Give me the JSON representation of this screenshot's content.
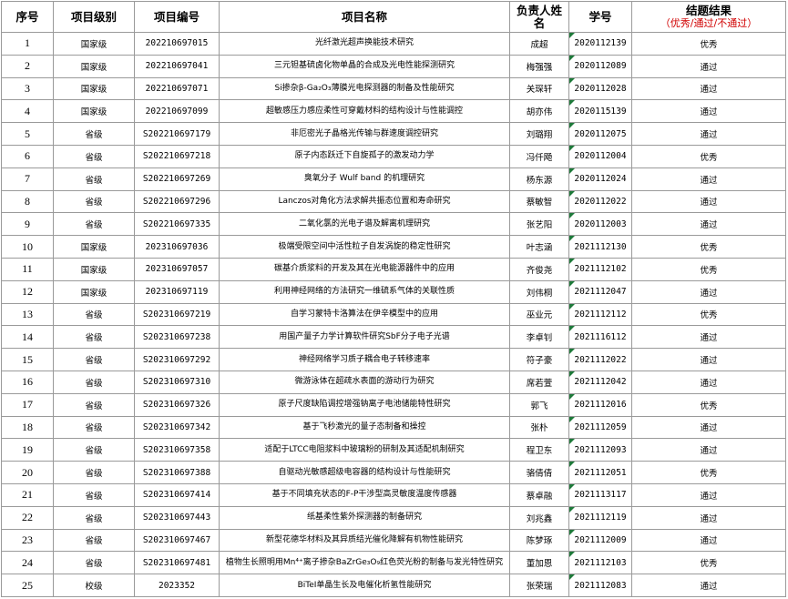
{
  "headers": {
    "seq": "序号",
    "level": "项目级别",
    "code": "项目编号",
    "name": "项目名称",
    "leader": "负责人姓名",
    "sid": "学号",
    "result": "结题结果",
    "result_note": "（优秀/通过/不通过）"
  },
  "rows": [
    {
      "seq": "1",
      "level": "国家级",
      "code": "202210697015",
      "name": "光纤激光超声换能技术研究",
      "leader": "成超",
      "sid": "2020112139",
      "result": "优秀"
    },
    {
      "seq": "2",
      "level": "国家级",
      "code": "202210697041",
      "name": "三元钽基硫卤化物单晶的合成及光电性能探测研究",
      "leader": "梅强强",
      "sid": "2020112089",
      "result": "通过"
    },
    {
      "seq": "3",
      "level": "国家级",
      "code": "202210697071",
      "name": "Si掺杂β-Ga₂O₃薄膜光电探测器的制备及性能研究",
      "leader": "关琛轩",
      "sid": "2020112028",
      "result": "通过"
    },
    {
      "seq": "4",
      "level": "国家级",
      "code": "202210697099",
      "name": "超敏感压力感应柔性可穿戴材料的结构设计与性能调控",
      "leader": "胡亦伟",
      "sid": "2020115139",
      "result": "通过"
    },
    {
      "seq": "5",
      "level": "省级",
      "code": "S202210697179",
      "name": "非厄密光子晶格光传输与群速度调控研究",
      "leader": "刘璐翔",
      "sid": "2020112075",
      "result": "通过"
    },
    {
      "seq": "6",
      "level": "省级",
      "code": "S202210697218",
      "name": "原子内态跃迁下自旋孤子的激发动力学",
      "leader": "冯仟飏",
      "sid": "2020112004",
      "result": "优秀"
    },
    {
      "seq": "7",
      "level": "省级",
      "code": "S202210697269",
      "name": "臭氧分子 Wulf band 的机理研究",
      "leader": "杨东源",
      "sid": "2020112024",
      "result": "通过"
    },
    {
      "seq": "8",
      "level": "省级",
      "code": "S202210697296",
      "name": "Lanczos对角化方法求解共振态位置和寿命研究",
      "leader": "蔡敏智",
      "sid": "2020112022",
      "result": "通过"
    },
    {
      "seq": "9",
      "level": "省级",
      "code": "S202210697335",
      "name": "二氧化氯的光电子谱及解离机理研究",
      "leader": "张艺阳",
      "sid": "2020112003",
      "result": "通过"
    },
    {
      "seq": "10",
      "level": "国家级",
      "code": "202310697036",
      "name": "极端受限空间中活性粒子自发涡旋的稳定性研究",
      "leader": "叶志涵",
      "sid": "2021112130",
      "result": "优秀"
    },
    {
      "seq": "11",
      "level": "国家级",
      "code": "202310697057",
      "name": "碳基介质浆料的开发及其在光电能源器件中的应用",
      "leader": "齐俊尧",
      "sid": "2021112102",
      "result": "优秀"
    },
    {
      "seq": "12",
      "level": "国家级",
      "code": "202310697119",
      "name": "利用神经网络的方法研究一维硫系气体的关联性质",
      "leader": "刘伟桐",
      "sid": "2021112047",
      "result": "通过"
    },
    {
      "seq": "13",
      "level": "省级",
      "code": "S202310697219",
      "name": "自学习蒙特卡洛算法在伊辛模型中的应用",
      "leader": "巫业元",
      "sid": "2021112112",
      "result": "优秀"
    },
    {
      "seq": "14",
      "level": "省级",
      "code": "S202310697238",
      "name": "用国产量子力学计算软件研究SbF分子电子光谱",
      "leader": "李卓钊",
      "sid": "2021116112",
      "result": "通过"
    },
    {
      "seq": "15",
      "level": "省级",
      "code": "S202310697292",
      "name": "神经网络学习质子耦合电子转移速率",
      "leader": "符子豪",
      "sid": "2021112022",
      "result": "通过"
    },
    {
      "seq": "16",
      "level": "省级",
      "code": "S202310697310",
      "name": "微游泳体在超疏水表面的游动行为研究",
      "leader": "席若萱",
      "sid": "2021112042",
      "result": "通过"
    },
    {
      "seq": "17",
      "level": "省级",
      "code": "S202310697326",
      "name": "原子尺度缺陷调控增强钠离子电池储能特性研究",
      "leader": "郭飞",
      "sid": "2021112016",
      "result": "优秀"
    },
    {
      "seq": "18",
      "level": "省级",
      "code": "S202310697342",
      "name": "基于飞秒激光的量子态制备和操控",
      "leader": "张朴",
      "sid": "2021112059",
      "result": "通过"
    },
    {
      "seq": "19",
      "level": "省级",
      "code": "S202310697358",
      "name": "适配于LTCC电阻浆料中玻璃粉的研制及其适配机制研究",
      "leader": "程卫东",
      "sid": "2021112093",
      "result": "通过"
    },
    {
      "seq": "20",
      "level": "省级",
      "code": "S202310697388",
      "name": "自驱动光敏感超级电容器的结构设计与性能研究",
      "leader": "骆倩倩",
      "sid": "2021112051",
      "result": "优秀"
    },
    {
      "seq": "21",
      "level": "省级",
      "code": "S202310697414",
      "name": "基于不同填充状态的F-P干涉型高灵敏度温度传感器",
      "leader": "蔡卓融",
      "sid": "2021113117",
      "result": "通过"
    },
    {
      "seq": "22",
      "level": "省级",
      "code": "S202310697443",
      "name": "纸基柔性紫外探测器的制备研究",
      "leader": "刘兆鑫",
      "sid": "2021112119",
      "result": "通过"
    },
    {
      "seq": "23",
      "level": "省级",
      "code": "S202310697467",
      "name": "新型花德华材料及其异质结光催化降解有机物性能研究",
      "leader": "陈梦琢",
      "sid": "2021112009",
      "result": "通过"
    },
    {
      "seq": "24",
      "level": "省级",
      "code": "S202310697481",
      "name": "植物生长照明用Mn⁴⁺离子掺杂BaZrGe₃O₉红色荧光粉的制备与发光特性研究",
      "leader": "董加恩",
      "sid": "2021112103",
      "result": "优秀"
    },
    {
      "seq": "25",
      "level": "校级",
      "code": "2023352",
      "name": "BiTeI单晶生长及电催化析氢性能研究",
      "leader": "张荣瑞",
      "sid": "2021112083",
      "result": "通过"
    }
  ]
}
